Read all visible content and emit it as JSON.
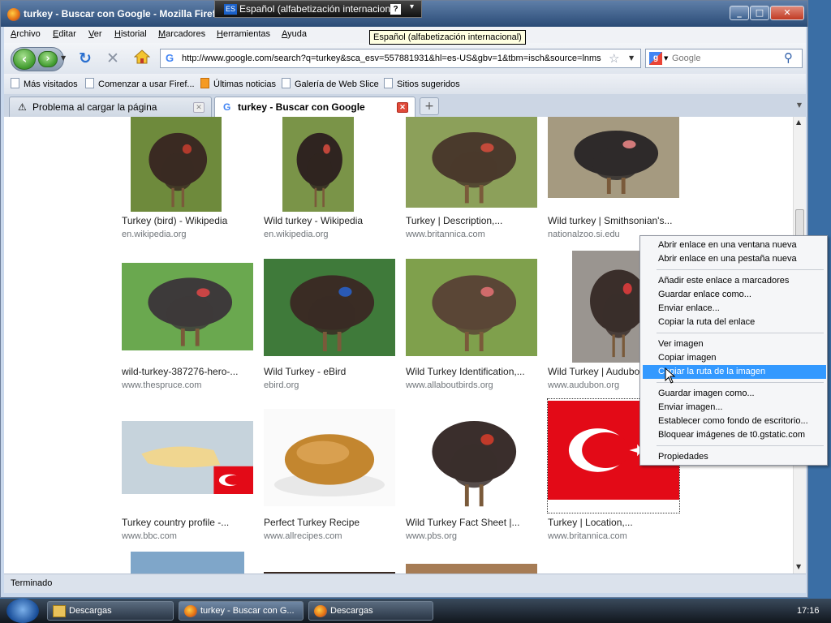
{
  "window": {
    "title": "turkey - Buscar con Google - Mozilla Firefox",
    "minimize": "_",
    "maximize": "□",
    "close": "✕"
  },
  "langbar": {
    "code": "ES",
    "label": "Español (alfabetización internacional)",
    "help": "?",
    "tooltip": "Español (alfabetización internacional)"
  },
  "menubar": [
    "Archivo",
    "Editar",
    "Ver",
    "Historial",
    "Marcadores",
    "Herramientas",
    "Ayuda"
  ],
  "nav": {
    "url": "http://www.google.com/search?q=turkey&sca_esv=557881931&hl=es-US&gbv=1&tbm=isch&source=lnms",
    "search_placeholder": "Google",
    "search_engine": "g"
  },
  "bookmarks": [
    {
      "label": "Más visitados",
      "icon": "page-icon"
    },
    {
      "label": "Comenzar a usar Firef...",
      "icon": "page-icon"
    },
    {
      "label": "Últimas noticias",
      "icon": "rss-icon"
    },
    {
      "label": "Galería de Web Slice",
      "icon": "page-icon"
    },
    {
      "label": "Sitios sugeridos",
      "icon": "page-icon"
    }
  ],
  "tabs": [
    {
      "label": "Problema al cargar la página",
      "icon": "warning-icon",
      "active": false
    },
    {
      "label": "turkey - Buscar con Google",
      "icon": "google-icon",
      "active": true
    }
  ],
  "results": [
    {
      "caption": "Turkey (bird) - Wikipedia",
      "source": "en.wikipedia.org"
    },
    {
      "caption": "Wild turkey - Wikipedia",
      "source": "en.wikipedia.org"
    },
    {
      "caption": "Turkey | Description,...",
      "source": "www.britannica.com"
    },
    {
      "caption": "Wild turkey | Smithsonian's...",
      "source": "nationalzoo.si.edu"
    },
    {
      "caption": "wild-turkey-387276-hero-...",
      "source": "www.thespruce.com"
    },
    {
      "caption": "Wild Turkey - eBird",
      "source": "ebird.org"
    },
    {
      "caption": "Wild Turkey Identification,...",
      "source": "www.allaboutbirds.org"
    },
    {
      "caption": "Wild Turkey | Audubo",
      "source": "www.audubon.org"
    },
    {
      "caption": "Turkey country profile -...",
      "source": "www.bbc.com"
    },
    {
      "caption": "Perfect Turkey Recipe",
      "source": "www.allrecipes.com"
    },
    {
      "caption": "Wild Turkey Fact Sheet |...",
      "source": "www.pbs.org"
    },
    {
      "caption": "Turkey | Location,...",
      "source": "www.britannica.com"
    }
  ],
  "context_menu": [
    "Abrir enlace en una ventana nueva",
    "Abrir enlace en una pestaña nueva",
    "Añadir este enlace a marcadores",
    "Guardar enlace como...",
    "Enviar enlace...",
    "Copiar la ruta del enlace",
    "Ver imagen",
    "Copiar imagen",
    "Copiar la ruta de la imagen",
    "Guardar imagen como...",
    "Enviar imagen...",
    "Establecer como fondo de escritorio...",
    "Bloquear imágenes de t0.gstatic.com",
    "Propiedades"
  ],
  "context_highlighted": "Copiar la ruta de la imagen",
  "status": "Terminado",
  "taskbar": {
    "tasks": [
      {
        "label": "Descargas",
        "icon": "folder-icon"
      },
      {
        "label": "turkey - Buscar con G...",
        "icon": "firefox-icon"
      },
      {
        "label": "Descargas",
        "icon": "firefox-icon"
      }
    ],
    "clock": "17:16"
  },
  "colors": {
    "highlight": "#3399ff",
    "turkey_flag_red": "#e30a17",
    "link_gray": "#70757a"
  }
}
